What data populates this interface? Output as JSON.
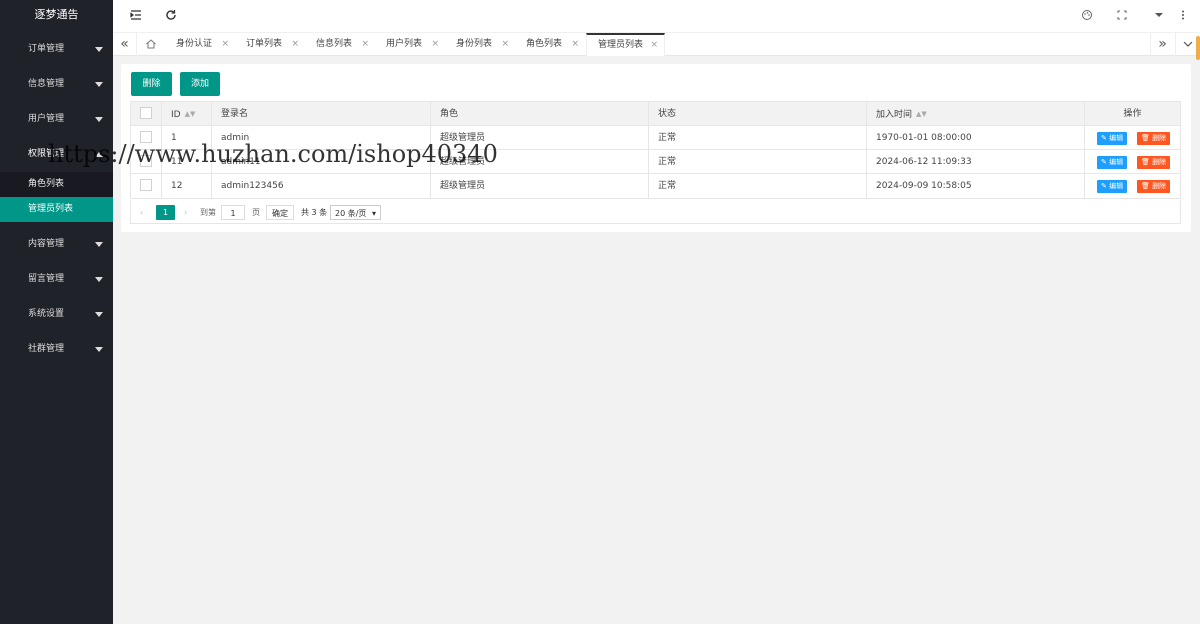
{
  "app": {
    "title": "逐梦通告"
  },
  "colors": {
    "accent": "#009688",
    "sidebar_bg": "#20222a",
    "edit": "#1e9fff",
    "danger": "#ff5722"
  },
  "sidebar": {
    "items": [
      {
        "label": "订单管理"
      },
      {
        "label": "信息管理"
      },
      {
        "label": "用户管理"
      },
      {
        "label": "权限管理"
      }
    ],
    "sub_items": [
      {
        "label": "角色列表"
      },
      {
        "label": "管理员列表"
      }
    ],
    "items_after": [
      {
        "label": "内容管理"
      },
      {
        "label": "留言管理"
      },
      {
        "label": "系统设置"
      },
      {
        "label": "社群管理"
      }
    ]
  },
  "topbar": {
    "icons": [
      "shrink-menu-icon",
      "refresh-icon",
      "theme-icon",
      "fullscreen-icon",
      "dropdown-icon",
      "more-icon"
    ]
  },
  "tabs": [
    {
      "label": "身份认证"
    },
    {
      "label": "订单列表"
    },
    {
      "label": "信息列表"
    },
    {
      "label": "用户列表"
    },
    {
      "label": "身份列表"
    },
    {
      "label": "角色列表"
    },
    {
      "label": "管理员列表"
    }
  ],
  "tab_close": "×",
  "toolbar": {
    "delete_label": "删除",
    "add_label": "添加"
  },
  "table": {
    "headers": [
      "ID",
      "登录名",
      "角色",
      "状态",
      "加入时间",
      "操作"
    ],
    "rows": [
      {
        "id": "1",
        "login": "admin",
        "role": "超级管理员",
        "status": "正常",
        "time": "1970-01-01 08:00:00"
      },
      {
        "id": "11",
        "login": "admin11",
        "role": "超级管理员",
        "status": "正常",
        "time": "2024-06-12 11:09:33"
      },
      {
        "id": "12",
        "login": "admin123456",
        "role": "超级管理员",
        "status": "正常",
        "time": "2024-09-09 10:58:05"
      }
    ],
    "edit_label": "编辑",
    "delete_label": "删除"
  },
  "pager": {
    "current": "1",
    "goto_label": "到第",
    "page_input": "1",
    "page_unit": "页",
    "confirm": "确定",
    "total": "共 3 条",
    "per_page": "20 条/页"
  },
  "watermark": "https://www.huzhan.com/ishop40340"
}
